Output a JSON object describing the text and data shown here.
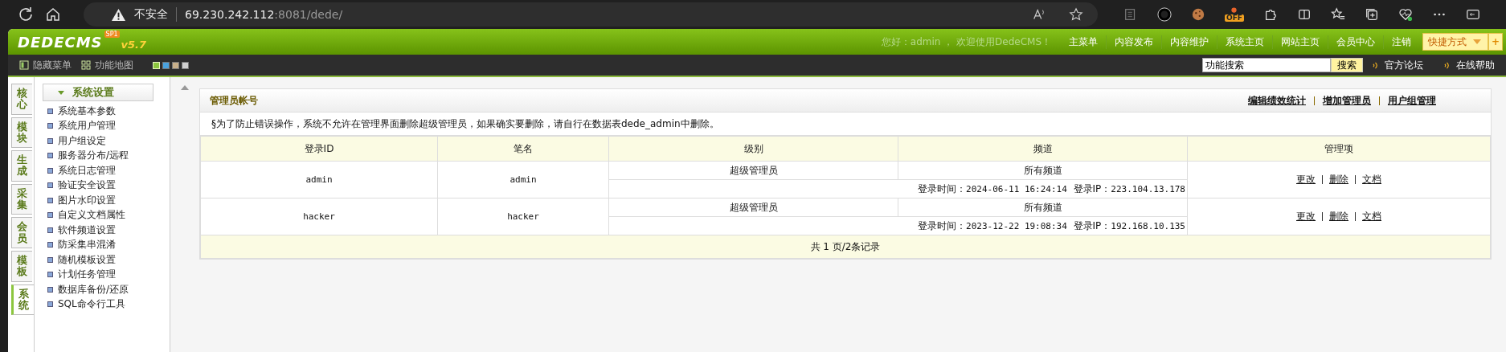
{
  "browser": {
    "security": "不安全",
    "url_host": "69.230.242.112",
    "url_rest": ":8081/dede/",
    "extension_badge": "OFF"
  },
  "header": {
    "logo": "DEDECMS",
    "edition": "SP1",
    "version": "v5.7",
    "greeting": "您好：admin ， 欢迎使用DedeCMS！",
    "nav": [
      "主菜单",
      "内容发布",
      "内容维护",
      "系统主页",
      "网站主页",
      "会员中心",
      "注销"
    ],
    "shortcut": "快捷方式",
    "shortcut_add": "+"
  },
  "toolbar": {
    "hide_menu": "隐藏菜单",
    "function_map": "功能地图",
    "skins": [
      {
        "color": "#8cc63f",
        "selected": true
      },
      {
        "color": "#4aa3df",
        "selected": false
      },
      {
        "color": "#c8b08a",
        "selected": false
      },
      {
        "color": "#d0d0d0",
        "selected": false
      }
    ],
    "search": {
      "value": "功能搜索",
      "button": "搜索"
    },
    "links": [
      "官方论坛",
      "在线帮助"
    ]
  },
  "side_tabs": [
    {
      "label": "核心",
      "selected": false
    },
    {
      "label": "模块",
      "selected": false
    },
    {
      "label": "生成",
      "selected": false
    },
    {
      "label": "采集",
      "selected": false
    },
    {
      "label": "会员",
      "selected": false
    },
    {
      "label": "模板",
      "selected": false
    },
    {
      "label": "系统",
      "selected": true
    }
  ],
  "menu": {
    "heading": "系统设置",
    "expanded": true,
    "items": [
      "系统基本参数",
      "系统用户管理",
      "用户组设定",
      "服务器分布/远程",
      "系统日志管理",
      "验证安全设置",
      "图片水印设置",
      "自定义文档属性",
      "软件频道设置",
      "防采集串混淆",
      "随机模板设置",
      "计划任务管理",
      "数据库备份/还原",
      "SQL命令行工具"
    ]
  },
  "panel": {
    "title": "管理员帐号",
    "links": [
      "编辑绩效统计",
      "增加管理员",
      "用户组管理"
    ],
    "notice": "§为了防止错误操作，系统不允许在管理界面删除超级管理员，如果确实要删除，请自行在数据表dede_admin中删除。",
    "table": {
      "columns": [
        "登录ID",
        "笔名",
        "级别",
        "频道",
        "管理项"
      ],
      "rows": [
        {
          "login_id": "admin",
          "pen_name": "admin",
          "level": "超级管理员",
          "channel": "所有频道",
          "login_time_label": "登录时间：",
          "login_time": "2024-06-11 16:24:14",
          "login_ip_label": "登录IP：",
          "login_ip": "223.104.13.178",
          "actions": [
            "更改",
            "删除",
            "文档"
          ]
        },
        {
          "login_id": "hacker",
          "pen_name": "hacker",
          "level": "超级管理员",
          "channel": "所有频道",
          "login_time_label": "登录时间：",
          "login_time": "2023-12-22 19:08:34",
          "login_ip_label": "登录IP：",
          "login_ip": "192.168.10.135",
          "actions": [
            "更改",
            "删除",
            "文档"
          ]
        }
      ],
      "footer": "共 1 页/2条记录"
    }
  }
}
